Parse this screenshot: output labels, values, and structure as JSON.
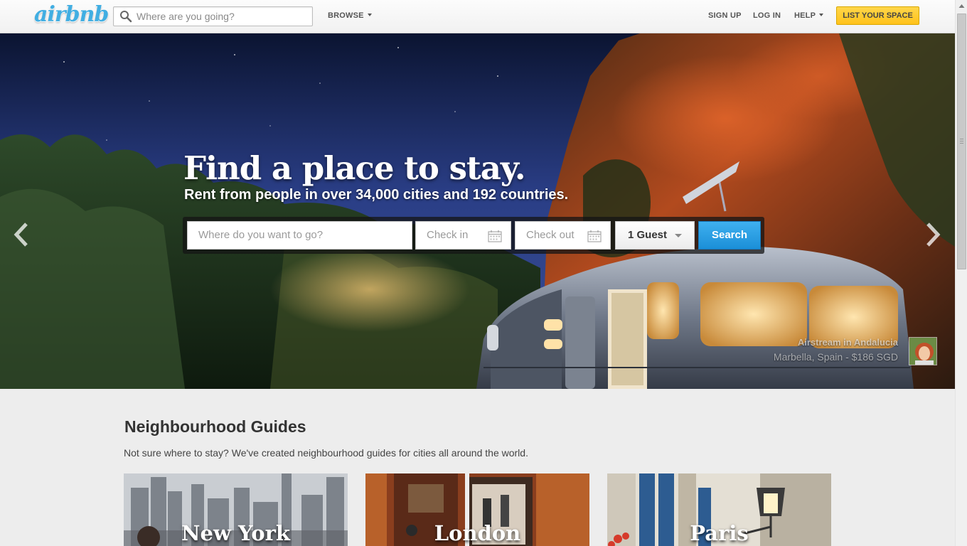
{
  "header": {
    "logo": "airbnb",
    "search_placeholder": "Where are you going?",
    "nav": {
      "browse": "BROWSE",
      "sign_up": "SIGN UP",
      "log_in": "LOG IN",
      "help": "HELP"
    },
    "list_space": "LIST YOUR SPACE"
  },
  "hero": {
    "title": "Find a place to stay.",
    "subtitle": "Rent from people in over 34,000 cities and 192 countries.",
    "search": {
      "where_placeholder": "Where do you want to go?",
      "checkin_placeholder": "Check in",
      "checkout_placeholder": "Check out",
      "guests": "1 Guest",
      "button": "Search"
    },
    "listing": {
      "name": "Airstream in Andalucia",
      "details": "Marbella, Spain - $186 SGD"
    }
  },
  "guides": {
    "title": "Neighbourhood Guides",
    "description": "Not sure where to stay? We've created neighbourhood guides for cities all around the world.",
    "cities": [
      "New York",
      "London",
      "Paris"
    ]
  },
  "colors": {
    "brand_blue": "#41aee2",
    "list_button": "#ffc21a",
    "search_button": "#2a9fe6",
    "page_background": "#ededed"
  }
}
